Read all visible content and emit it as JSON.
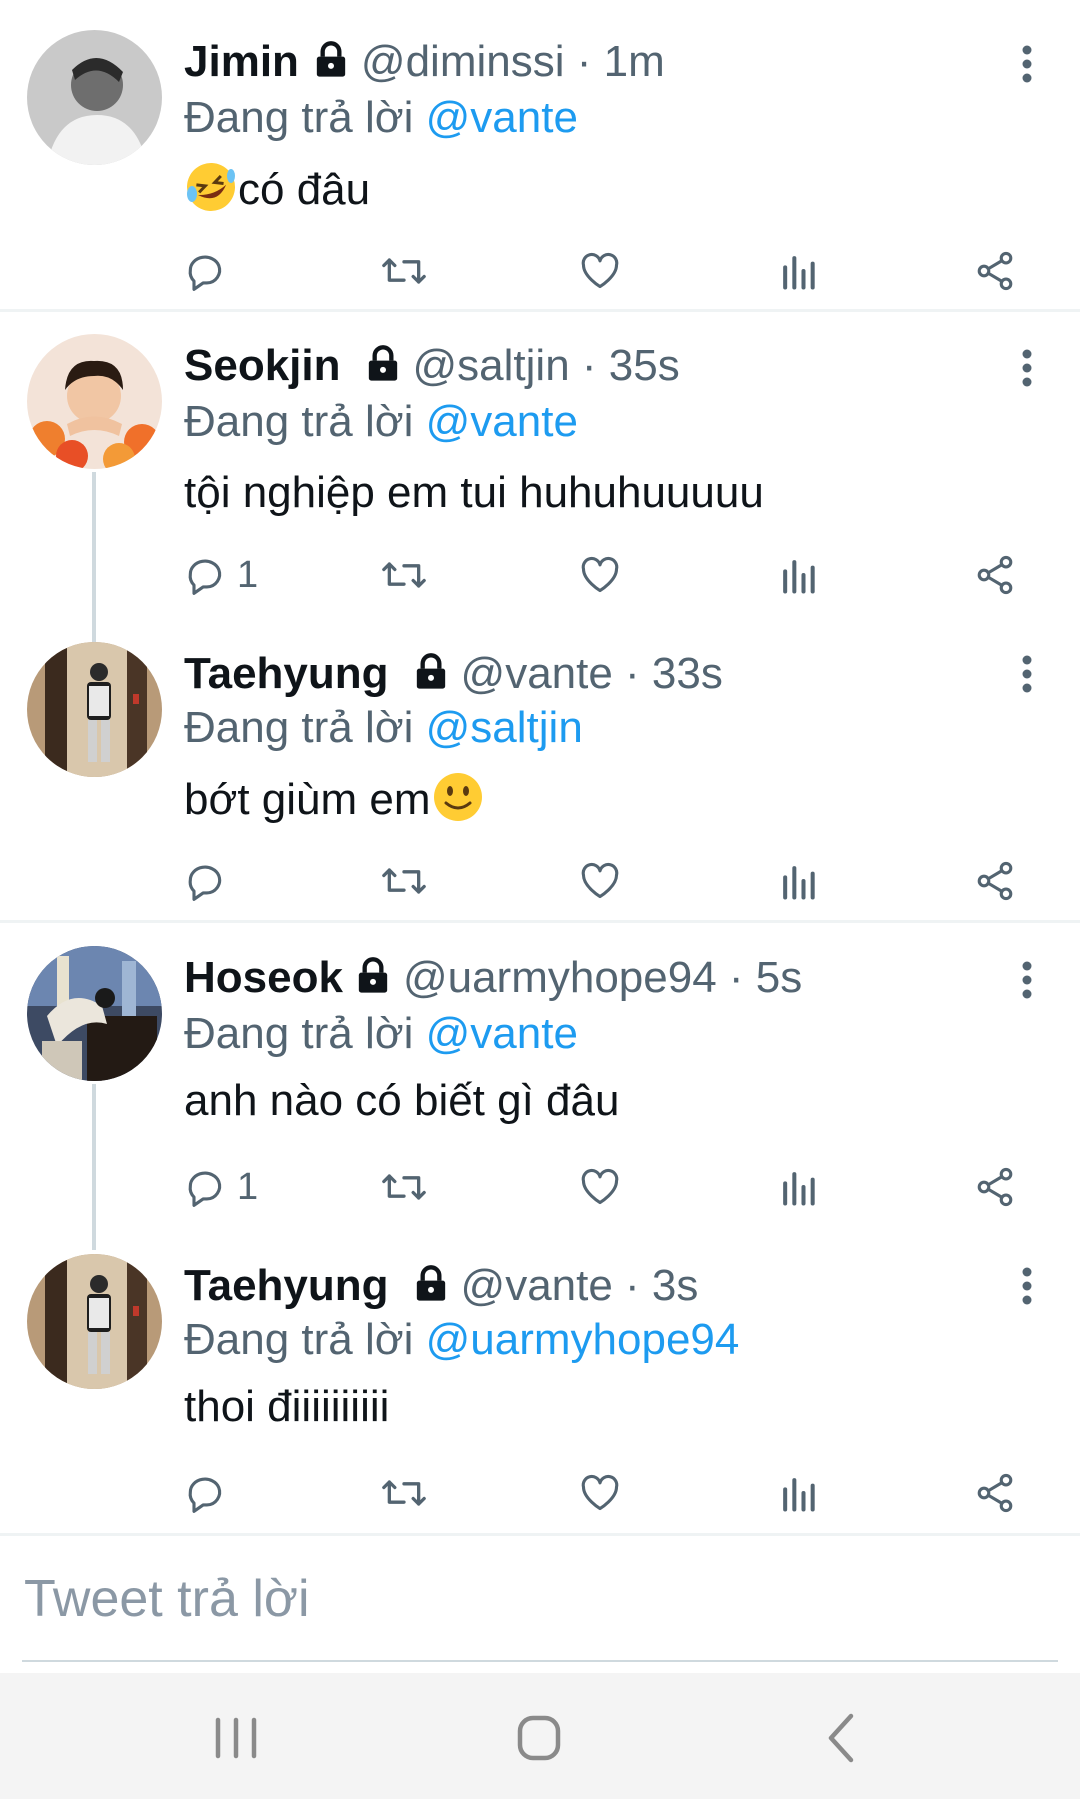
{
  "tweets": [
    {
      "name": "Jimin",
      "handle_time": "@diminssi · 1m",
      "reply_prefix": "Đang trả lời",
      "reply_to": "@vante",
      "text": "có đâu",
      "reply_count": "",
      "emoji": "rolling-on-floor-laughing-emoji"
    },
    {
      "name": "Seokjin",
      "handle_time": "@saltjin · 35s",
      "reply_prefix": "Đang trả lời",
      "reply_to": "@vante",
      "text": "tội nghiệp em tui huhuhuuuuu",
      "reply_count": "1"
    },
    {
      "name": "Taehyung",
      "handle_time": "@vante · 33s",
      "reply_prefix": "Đang trả lời",
      "reply_to": "@saltjin",
      "text": "bớt giùm em",
      "reply_count": "",
      "emoji": "slightly-smiling-face-emoji"
    },
    {
      "name": "Hoseok",
      "handle_time": "@uarmyhope94 · 5s",
      "reply_prefix": "Đang trả lời",
      "reply_to": "@vante",
      "text": "anh nào có biết gì đâu",
      "reply_count": "1"
    },
    {
      "name": "Taehyung",
      "handle_time": "@vante · 3s",
      "reply_prefix": "Đang trả lời",
      "reply_to": "@uarmyhope94",
      "text": "thoi điiiiiiiiii",
      "reply_count": ""
    }
  ],
  "compose": {
    "placeholder": "Tweet trả lời"
  },
  "colors": {
    "link": "#1d9bf0",
    "secondary": "#536471",
    "text": "#0f1419"
  }
}
